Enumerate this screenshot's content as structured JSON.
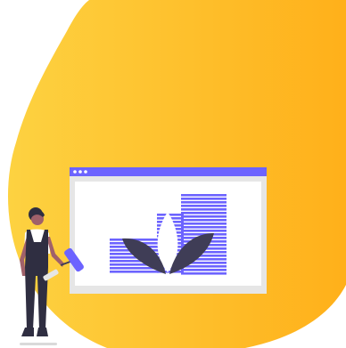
{
  "illustration": {
    "colors": {
      "blob_start": "#FDD241",
      "blob_end": "#FFB01A",
      "window_frame": "#E6E6E6",
      "window_bar": "#6C63FF",
      "dot": "#FFFFFF",
      "stripes": "#6C63FF",
      "leaf_dark": "#3F3D56",
      "leaf_light": "#FFFFFF",
      "person_dark": "#2F2E41",
      "skin": "#A0616A",
      "shirt": "#FFFFFF",
      "roller": "#6C63FF"
    },
    "icons": [
      "browser-window-icon",
      "plant-icon",
      "person-icon",
      "paint-roller-icon"
    ]
  }
}
